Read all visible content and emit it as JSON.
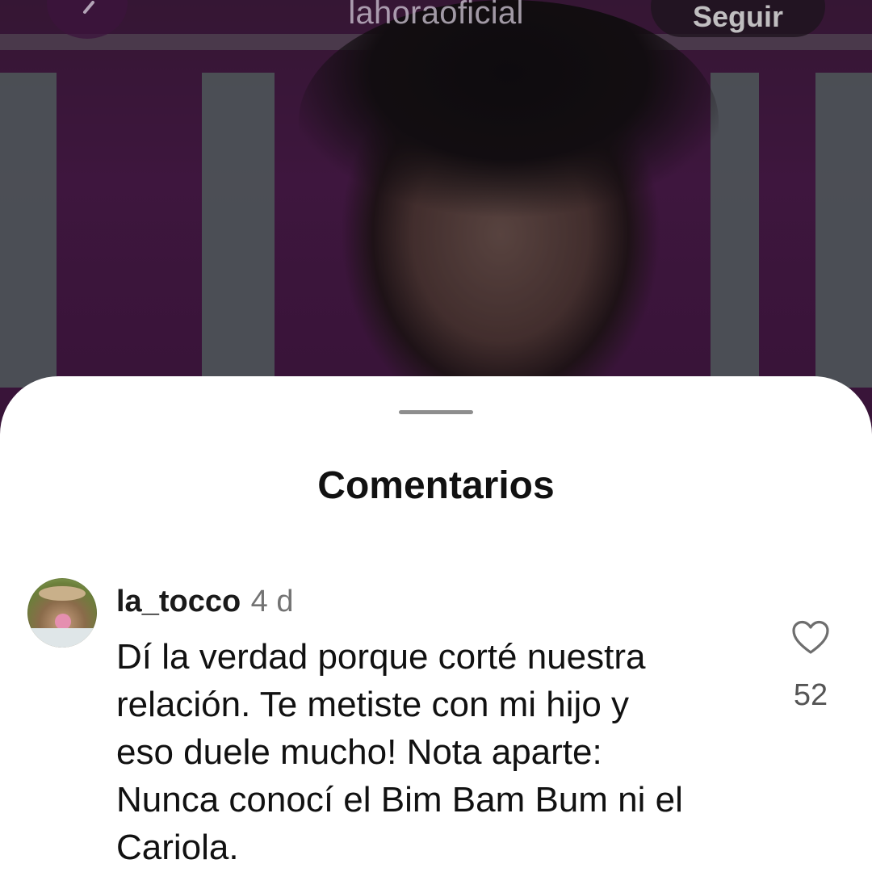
{
  "header": {
    "account_name": "lahoraoficial",
    "follow_label": "Seguir"
  },
  "icons": {
    "back": "chevron-left-icon",
    "like": "heart-outline-icon"
  },
  "sheet": {
    "title": "Comentarios"
  },
  "comments": [
    {
      "username": "la_tocco",
      "time": "4 d",
      "text": "Dí la verdad porque corté nuestra\nrelación. Te metiste con mi hijo y\neso duele mucho!  Nota aparte:\nNunca conocí el Bim Bam Bum ni el\nCariola.",
      "likes": "52"
    }
  ],
  "colors": {
    "sheet_background": "#ffffff",
    "text_primary": "#111111",
    "text_secondary": "#737373"
  }
}
